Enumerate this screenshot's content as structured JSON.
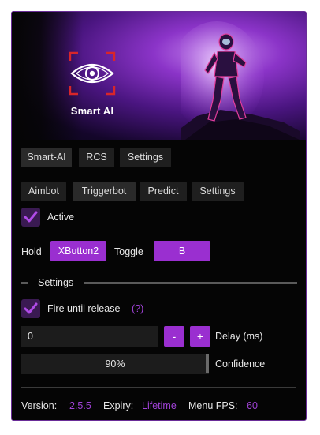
{
  "banner": {
    "brand": "Smart AI"
  },
  "main_tabs": [
    {
      "label": "Smart-AI",
      "active": true
    },
    {
      "label": "RCS",
      "active": false
    },
    {
      "label": "Settings",
      "active": false
    }
  ],
  "sub_tabs": [
    {
      "label": "Aimbot",
      "active": false
    },
    {
      "label": "Triggerbot",
      "active": true
    },
    {
      "label": "Predict",
      "active": false
    },
    {
      "label": "Settings",
      "active": false
    }
  ],
  "active": {
    "label": "Active",
    "checked": true
  },
  "hold": {
    "label": "Hold",
    "key": "XButton2",
    "toggle_label": "Toggle",
    "toggle_key": "B"
  },
  "settings_section": {
    "title": "Settings"
  },
  "fire_until_release": {
    "label": "Fire until release",
    "help": "(?)",
    "checked": true
  },
  "delay": {
    "value": "0",
    "minus": "-",
    "plus": "+",
    "label": "Delay (ms)"
  },
  "confidence": {
    "value_text": "90%",
    "value": 0.9,
    "label": "Confidence"
  },
  "footer": {
    "version_label": "Version:",
    "version": "2.5.5",
    "expiry_label": "Expiry:",
    "expiry": "Lifetime",
    "fps_label": "Menu FPS:",
    "fps": "60"
  },
  "colors": {
    "accent": "#9a2fd0",
    "border": "#6a2d98",
    "background": "#050505"
  }
}
